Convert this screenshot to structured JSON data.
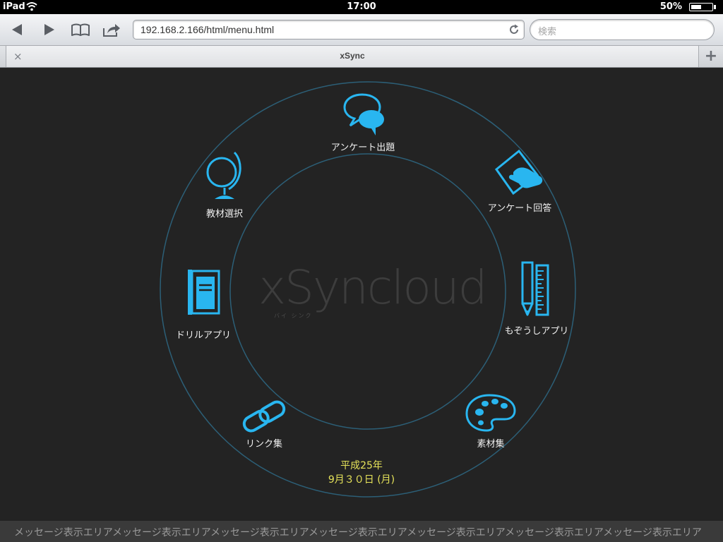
{
  "status_bar": {
    "device": "iPad",
    "time": "17:00",
    "battery": "50%",
    "battery_level": 0.5
  },
  "toolbar": {
    "url": "192.168.2.166/html/menu.html",
    "search_placeholder": "検索"
  },
  "tabs": {
    "title": "xSync",
    "close_symbol": "×",
    "new_tab_symbol": "+"
  },
  "app": {
    "logo": "xSyncloud",
    "logo_sub": "バイ シンク",
    "menu": {
      "survey_question": "アンケート出題",
      "survey_answer": "アンケート回答",
      "mozoushi": "もぞうしアプリ",
      "materials": "素材集",
      "links": "リンク集",
      "drill": "ドリルアプリ",
      "textbook": "教材選択"
    },
    "date_line1": "平成25年",
    "date_line2": "9月３０日 (月)",
    "message": "メッセージ表示エリアメッセージ表示エリアメッセージ表示エリアメッセージ表示エリアメッセージ表示エリアメッセージ表示エリアメッセージ表示エリア"
  },
  "colors": {
    "icon": "#29b6f0",
    "ring": "#2c5f77",
    "date": "#e6e35a",
    "background": "#232323"
  }
}
